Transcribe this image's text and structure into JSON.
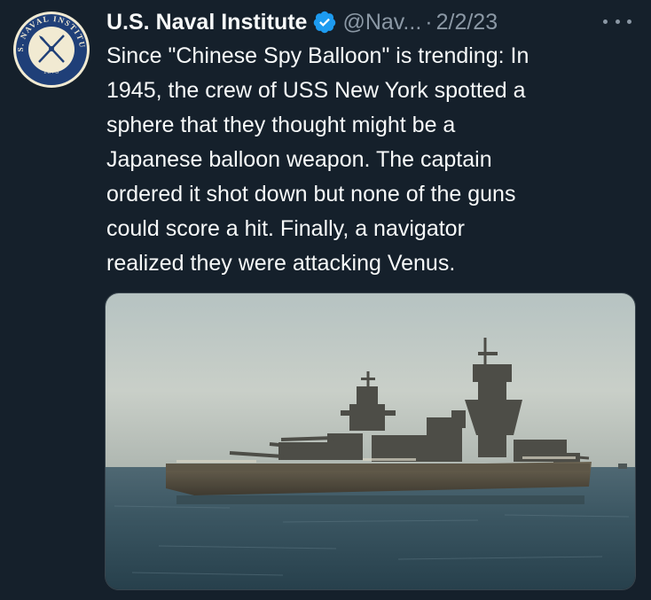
{
  "author": {
    "name": "U.S. Naval Institute",
    "handle": "@Nav...",
    "verified": true,
    "verified_color": "#1d9bf0",
    "avatar_icon": "naval-institute-seal",
    "avatar_seal_text": "U.S. NAVAL INSTITUTE",
    "avatar_seal_year": "1873"
  },
  "meta": {
    "separator": "·",
    "date": "2/2/23"
  },
  "more_icon": "ellipsis-horizontal",
  "tweet": {
    "text": "Since \"Chinese Spy Balloon\" is trending: In\n1945, the crew of USS New York spotted a\nsphere that they thought might be a\nJapanese balloon weapon. The captain\nordered it shot down but none of the guns\ncould score a hit. Finally, a navigator\nrealized they were attacking Venus."
  },
  "media": {
    "type": "photo",
    "subject": "battleship-at-sea"
  },
  "colors": {
    "background": "#15202b",
    "text_primary": "#f7f9f9",
    "text_secondary": "#8b98a5"
  }
}
